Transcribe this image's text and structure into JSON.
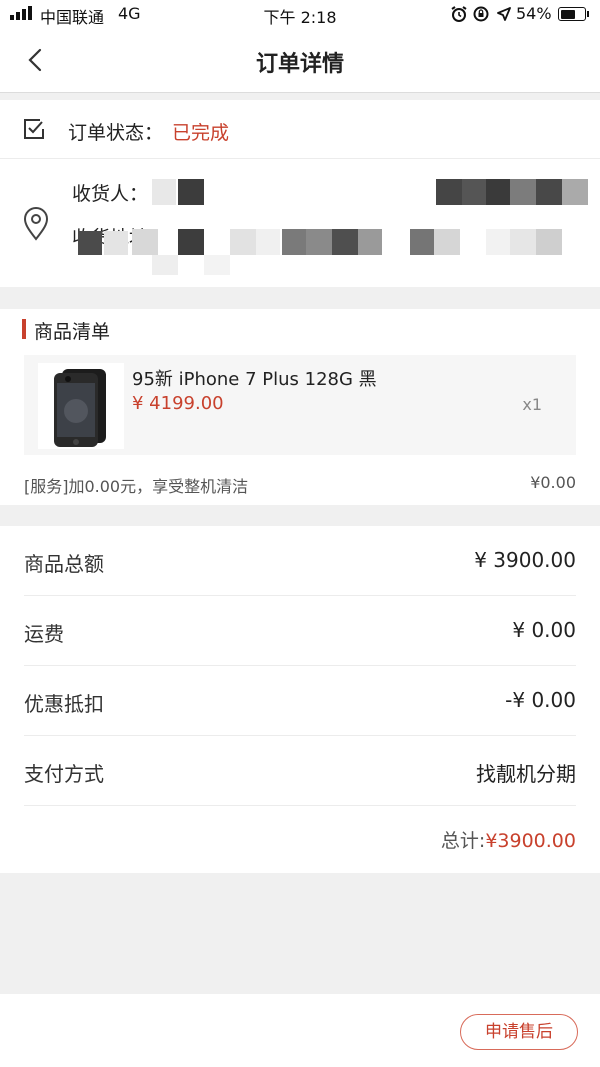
{
  "status_bar": {
    "carrier": "中国联通",
    "network": "4G",
    "time": "下午 2:18",
    "battery": "54%"
  },
  "nav": {
    "title": "订单详情"
  },
  "order_status": {
    "label": "订单状态：",
    "value": "已完成"
  },
  "address": {
    "receiver_label": "收货人：",
    "address_label": "收货地址："
  },
  "goods": {
    "section_title": "商品清单",
    "product": {
      "name": "95新 iPhone 7 Plus 128G 黑",
      "price": "¥ 4199.00",
      "qty": "x1"
    },
    "service": {
      "text": "[服务]加0.00元，享受整机清洁",
      "price": "¥0.00"
    }
  },
  "summary": {
    "rows": [
      {
        "label": "商品总额",
        "value": "¥ 3900.00"
      },
      {
        "label": "运费",
        "value": "¥ 0.00"
      },
      {
        "label": "优惠抵扣",
        "value": "-¥ 0.00"
      },
      {
        "label": "支付方式",
        "value": "找靓机分期"
      }
    ],
    "total_label": "总计:",
    "total_value": "¥3900.00"
  },
  "footer": {
    "after_sale_label": "申请售后"
  },
  "colors": {
    "accent": "#c8412d",
    "background": "#f0f0f0"
  }
}
